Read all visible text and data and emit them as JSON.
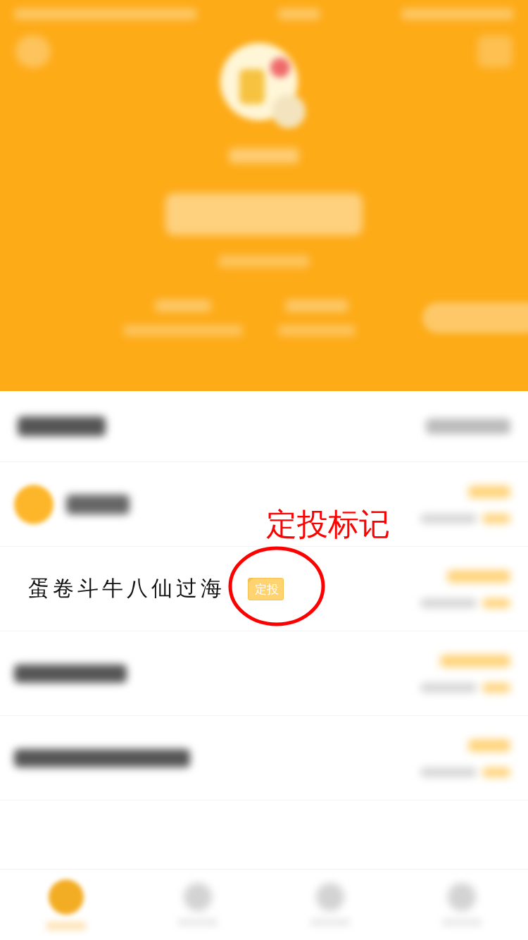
{
  "funds": [
    {
      "kind": "icon-blurred"
    },
    {
      "kind": "named",
      "name": "蛋卷斗牛八仙过海",
      "tag": "定投"
    },
    {
      "kind": "blurred"
    },
    {
      "kind": "blurred"
    }
  ],
  "annotation": {
    "label": "定投标记"
  },
  "tabs": [
    {
      "selected": true
    },
    {
      "selected": false
    },
    {
      "selected": false
    },
    {
      "selected": false
    }
  ]
}
